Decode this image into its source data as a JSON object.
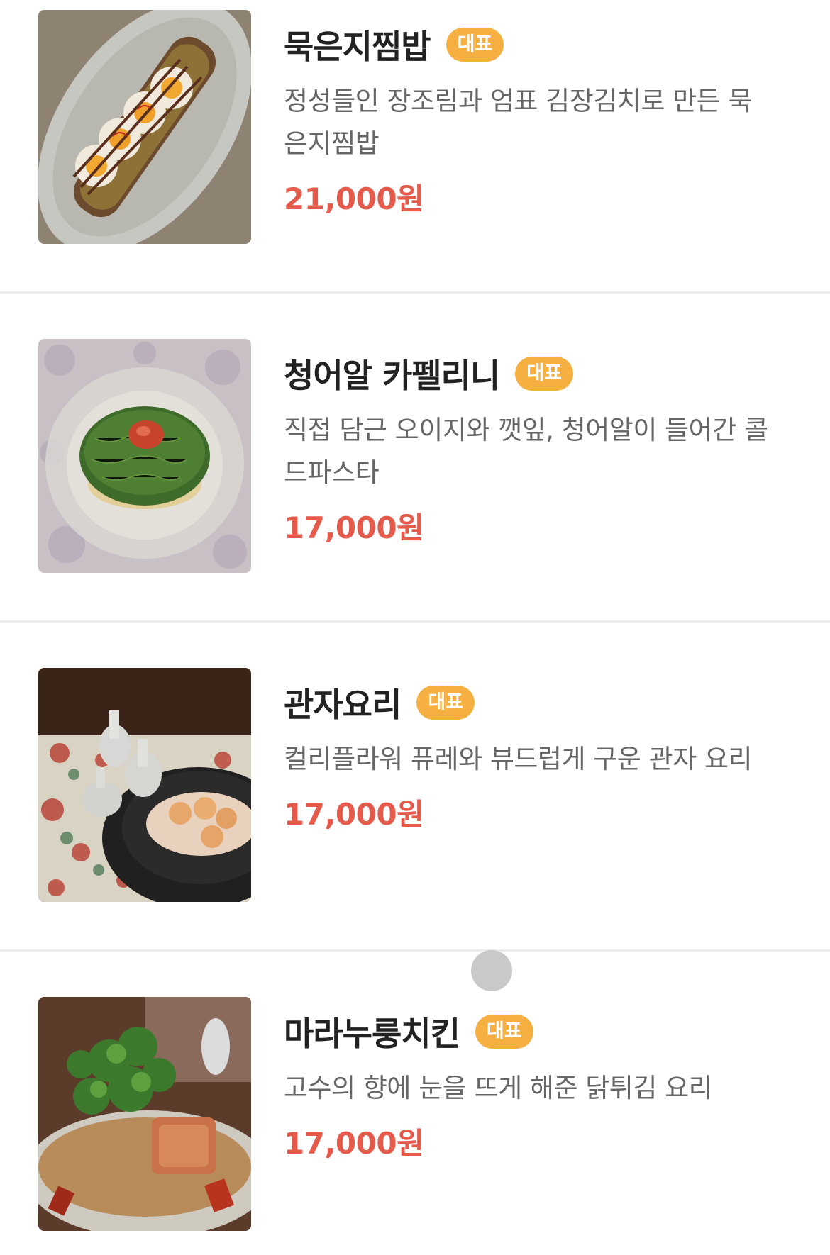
{
  "menu": {
    "badge_label": "대표",
    "items": [
      {
        "name": "묵은지찜밥",
        "description": "정성들인 장조림과 엄표 김장김치로 만든 묵은지찜밥",
        "desc_line1": "정성들인 장조림과 엄표 김장김치로 만든 묵",
        "desc_line2": "은지찜밥",
        "price": "21,000원",
        "image": "braised-kimchi-rice-with-eggs-photo"
      },
      {
        "name": "청어알 카펠리니",
        "description": "직접 담근 오이지와 깻잎, 청어알이 들어간 콜드파스타",
        "desc_line1": "직접 담근 오이지와 깻잎, 청어알이 들어간 콜",
        "desc_line2": "드파스타",
        "price": "17,000원",
        "image": "herring-roe-capellini-photo"
      },
      {
        "name": "관자요리",
        "description": "컬리플라워 퓨레와 뷰드럽게 구운 관자 요리",
        "price": "17,000원",
        "image": "scallop-dish-photo"
      },
      {
        "name": "마라누룽치킨",
        "description": "고수의 향에 눈을 뜨게 해준 닭튀김 요리",
        "price": "17,000원",
        "image": "mala-crispy-chicken-photo"
      }
    ]
  },
  "colors": {
    "badge": "#f5b041",
    "price": "#e65a4c",
    "title": "#222222",
    "description": "#666666",
    "divider": "#ececec"
  }
}
